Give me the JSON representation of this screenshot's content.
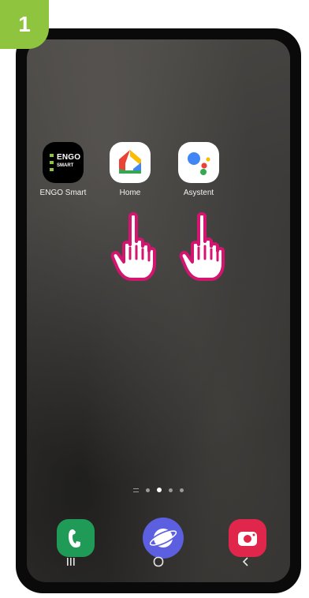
{
  "step_badge": "1",
  "apps": [
    {
      "label": "ENGO Smart",
      "logo_line1": "ENGO",
      "logo_line2": "SMART"
    },
    {
      "label": "Home"
    },
    {
      "label": "Asystent"
    }
  ],
  "page_indicator": {
    "pages": 4,
    "active": 1
  },
  "dock": [
    "phone-icon",
    "internet-icon",
    "camera-icon"
  ],
  "navigation": [
    "recent-apps",
    "home",
    "back"
  ],
  "colors": {
    "badge": "#8fc43f",
    "hand_outline": "#d4156f",
    "phone_app": "#1f9b57",
    "internet_app": "#5b5fe0",
    "camera_app": "#e0264b"
  }
}
